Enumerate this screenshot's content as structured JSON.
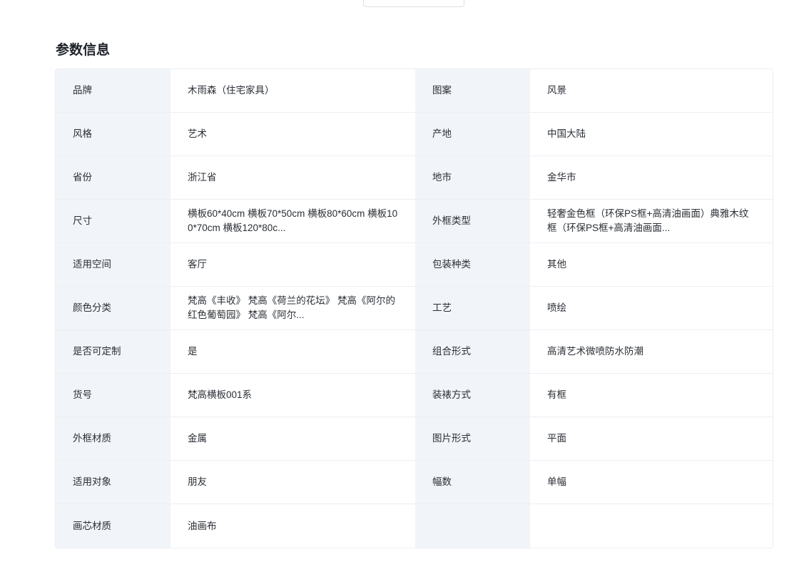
{
  "section": {
    "title": "参数信息"
  },
  "params": {
    "rows": [
      {
        "l1": "品牌",
        "v1": "木雨森（住宅家具）",
        "l2": "图案",
        "v2": "风景"
      },
      {
        "l1": "风格",
        "v1": "艺术",
        "l2": "产地",
        "v2": "中国大陆"
      },
      {
        "l1": "省份",
        "v1": "浙江省",
        "l2": "地市",
        "v2": "金华市"
      },
      {
        "l1": "尺寸",
        "v1": "横板60*40cm 横板70*50cm 横板80*60cm 横板100*70cm 横板120*80c...",
        "l2": "外框类型",
        "v2": "轻奢金色框（环保PS框+高清油画面）典雅木纹框（环保PS框+高清油画面..."
      },
      {
        "l1": "适用空间",
        "v1": "客厅",
        "l2": "包装种类",
        "v2": "其他"
      },
      {
        "l1": "颜色分类",
        "v1": "梵高《丰收》 梵高《荷兰的花坛》 梵高《阿尔的红色葡萄园》 梵高《阿尔...",
        "l2": "工艺",
        "v2": "喷绘"
      },
      {
        "l1": "是否可定制",
        "v1": "是",
        "l2": "组合形式",
        "v2": "高清艺术微喷防水防潮"
      },
      {
        "l1": "货号",
        "v1": "梵高横板001系",
        "l2": "装裱方式",
        "v2": "有框"
      },
      {
        "l1": "外框材质",
        "v1": "金属",
        "l2": "图片形式",
        "v2": "平面"
      },
      {
        "l1": "适用对象",
        "v1": "朋友",
        "l2": "幅数",
        "v2": "单幅"
      },
      {
        "l1": "画芯材质",
        "v1": "油画布",
        "l2": "",
        "v2": ""
      }
    ]
  }
}
